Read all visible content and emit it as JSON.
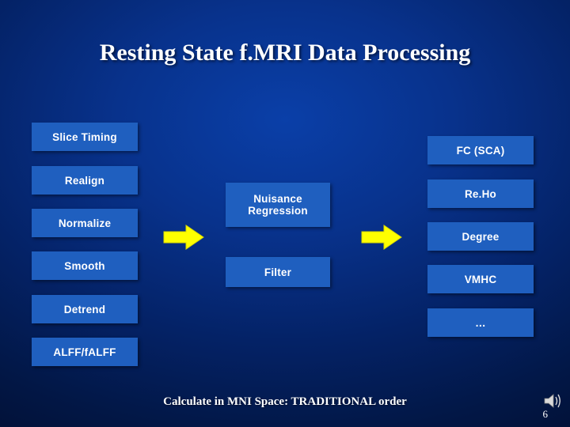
{
  "slide": {
    "title": "Resting State f.MRI Data Processing",
    "footer": "Calculate in MNI Space: TRADITIONAL order",
    "page_number": "6",
    "colors": {
      "box_fill": "#1f5fbf",
      "box_text": "#ffffff",
      "arrow": "#ffff00",
      "background_top": "#0a3fa8",
      "background_bottom": "#010d2e",
      "title_text": "#ffffff"
    }
  },
  "column1": {
    "items": [
      {
        "label": "Slice Timing"
      },
      {
        "label": "Realign"
      },
      {
        "label": "Normalize"
      },
      {
        "label": "Smooth"
      },
      {
        "label": "Detrend"
      },
      {
        "label": "ALFF/fALFF"
      }
    ]
  },
  "column2": {
    "items": [
      {
        "label": "Nuisance Regression"
      },
      {
        "label": "Filter"
      }
    ]
  },
  "column3": {
    "items": [
      {
        "label": "FC (SCA)"
      },
      {
        "label": "Re.Ho"
      },
      {
        "label": "Degree"
      },
      {
        "label": "VMHC"
      },
      {
        "label": "…"
      }
    ]
  },
  "arrows": [
    {
      "name": "arrow-stage-1-to-2"
    },
    {
      "name": "arrow-stage-2-to-3"
    }
  ]
}
